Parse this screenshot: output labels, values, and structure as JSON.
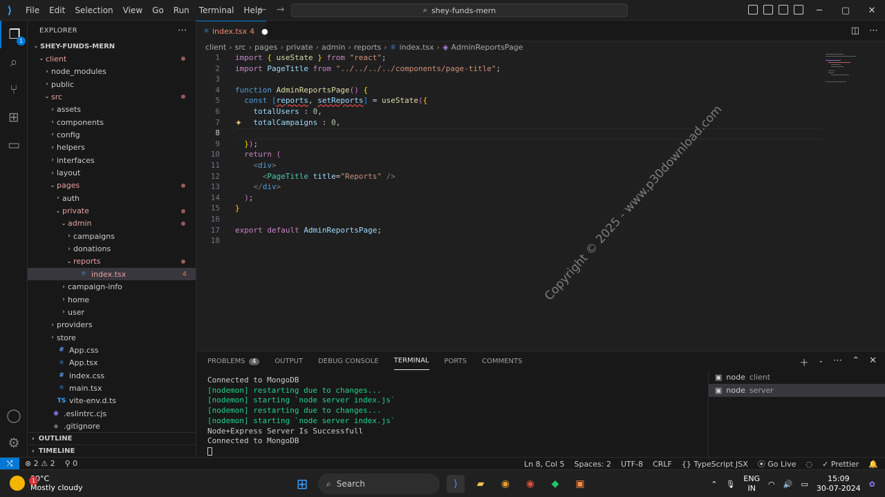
{
  "titlebar": {
    "menus": [
      "File",
      "Edit",
      "Selection",
      "View",
      "Go",
      "Run",
      "Terminal",
      "Help"
    ],
    "search": "shey-funds-mern"
  },
  "activity_badge": "1",
  "explorer": {
    "title": "EXPLORER",
    "tree": [
      {
        "label": "SHEY-FUNDS-MERN",
        "depth": 0,
        "type": "root"
      },
      {
        "label": "client",
        "depth": 1,
        "type": "folder-open",
        "modified": true
      },
      {
        "label": "node_modules",
        "depth": 2,
        "type": "folder"
      },
      {
        "label": "public",
        "depth": 2,
        "type": "folder"
      },
      {
        "label": "src",
        "depth": 2,
        "type": "folder-open",
        "modified": true
      },
      {
        "label": "assets",
        "depth": 3,
        "type": "folder"
      },
      {
        "label": "components",
        "depth": 3,
        "type": "folder"
      },
      {
        "label": "config",
        "depth": 3,
        "type": "folder"
      },
      {
        "label": "helpers",
        "depth": 3,
        "type": "folder"
      },
      {
        "label": "interfaces",
        "depth": 3,
        "type": "folder"
      },
      {
        "label": "layout",
        "depth": 3,
        "type": "folder"
      },
      {
        "label": "pages",
        "depth": 3,
        "type": "folder-open",
        "modified": true
      },
      {
        "label": "auth",
        "depth": 4,
        "type": "folder"
      },
      {
        "label": "private",
        "depth": 4,
        "type": "folder-open",
        "modified": true
      },
      {
        "label": "admin",
        "depth": 5,
        "type": "folder-open",
        "modified": true
      },
      {
        "label": "campaigns",
        "depth": 6,
        "type": "folder"
      },
      {
        "label": "donations",
        "depth": 6,
        "type": "folder"
      },
      {
        "label": "reports",
        "depth": 6,
        "type": "folder-open",
        "modified": true
      },
      {
        "label": "index.tsx",
        "depth": 7,
        "type": "file-tsx",
        "count": "4",
        "selected": true
      },
      {
        "label": "campaign-info",
        "depth": 5,
        "type": "folder"
      },
      {
        "label": "home",
        "depth": 5,
        "type": "folder"
      },
      {
        "label": "user",
        "depth": 5,
        "type": "folder"
      },
      {
        "label": "providers",
        "depth": 3,
        "type": "folder"
      },
      {
        "label": "store",
        "depth": 3,
        "type": "folder"
      },
      {
        "label": "App.css",
        "depth": 3,
        "type": "file-css"
      },
      {
        "label": "App.tsx",
        "depth": 3,
        "type": "file-tsx"
      },
      {
        "label": "index.css",
        "depth": 3,
        "type": "file-css"
      },
      {
        "label": "main.tsx",
        "depth": 3,
        "type": "file-tsx"
      },
      {
        "label": "vite-env.d.ts",
        "depth": 3,
        "type": "file-ts"
      },
      {
        "label": ".eslintrc.cjs",
        "depth": 2,
        "type": "file-eslint"
      },
      {
        "label": ".gitignore",
        "depth": 2,
        "type": "file-git"
      }
    ],
    "outline": "OUTLINE",
    "timeline": "TIMELINE"
  },
  "tab": {
    "name": "index.tsx",
    "count": "4"
  },
  "breadcrumb": [
    "client",
    "src",
    "pages",
    "private",
    "admin",
    "reports",
    "index.tsx",
    "AdminReportsPage"
  ],
  "code_lines": [
    "import { useState } from \"react\";",
    "import PageTitle from \"../../../../components/page-title\";",
    "",
    "function AdminReportsPage() {",
    "  const [reports, setReports] = useState({",
    "    totalUsers : 0,",
    "    totalCampaigns : 0,",
    "",
    "  });",
    "  return (",
    "    <div>",
    "      <PageTitle title=\"Reports\" />",
    "    </div>",
    "  );",
    "}",
    "",
    "export default AdminReportsPage;",
    ""
  ],
  "current_line": 8,
  "watermark": "Copyright © 2025 - www.p30download.com",
  "panel": {
    "tabs": [
      "PROBLEMS",
      "OUTPUT",
      "DEBUG CONSOLE",
      "TERMINAL",
      "PORTS",
      "COMMENTS"
    ],
    "problems_count": "4",
    "active_tab": "TERMINAL",
    "terminal_lines": [
      {
        "text": "Connected to MongoDB",
        "color": "white"
      },
      {
        "text": "[nodemon] restarting due to changes...",
        "color": "green"
      },
      {
        "text": "[nodemon] starting `node server index.js`",
        "color": "green"
      },
      {
        "text": "[nodemon] restarting due to changes...",
        "color": "green"
      },
      {
        "text": "[nodemon] starting `node server index.js`",
        "color": "green"
      },
      {
        "text": "Node+Express Server Is Successfull",
        "color": "white"
      },
      {
        "text": "Connected to MongoDB",
        "color": "white"
      }
    ],
    "terminals": [
      {
        "name": "node",
        "desc": "client"
      },
      {
        "name": "node",
        "desc": "server",
        "selected": true
      }
    ]
  },
  "status": {
    "errors": "2",
    "warnings": "2",
    "ports": "0",
    "position": "Ln 8, Col 5",
    "spaces": "Spaces: 2",
    "encoding": "UTF-8",
    "eol": "CRLF",
    "language": "TypeScript JSX",
    "golive": "Go Live",
    "prettier": "Prettier"
  },
  "taskbar": {
    "temp": "30°C",
    "weather": "Mostly cloudy",
    "weather_badge": "1",
    "search": "Search",
    "lang1": "ENG",
    "lang2": "IN",
    "time": "15:09",
    "date": "30-07-2024"
  }
}
